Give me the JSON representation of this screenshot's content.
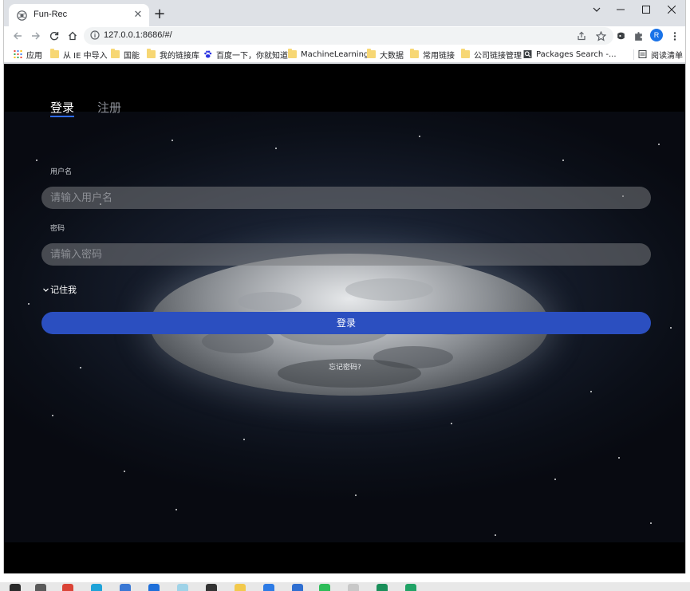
{
  "browser": {
    "tab_title": "Fun-Rec",
    "url": "127.0.0.1:8686/#/",
    "profile_initial": "R"
  },
  "bookmarks": [
    {
      "label": "应用",
      "icon": "apps-grid-icon"
    },
    {
      "label": "从 IE 中导入",
      "icon": "folder-icon"
    },
    {
      "label": "国能",
      "icon": "folder-icon"
    },
    {
      "label": "我的链接库",
      "icon": "folder-icon"
    },
    {
      "label": "百度一下，你就知道",
      "icon": "baidu-paw-icon"
    },
    {
      "label": "MachineLearning",
      "icon": "folder-icon"
    },
    {
      "label": "大数据",
      "icon": "folder-icon"
    },
    {
      "label": "常用链接",
      "icon": "folder-icon"
    },
    {
      "label": "公司链接管理",
      "icon": "folder-icon"
    },
    {
      "label": "Packages Search -...",
      "icon": "search-icon"
    },
    {
      "label": "阅读清单",
      "icon": "reading-list-icon"
    }
  ],
  "login": {
    "tab_login": "登录",
    "tab_register": "注册",
    "username_label": "用户名",
    "username_placeholder": "请输入用户名",
    "password_label": "密码",
    "password_placeholder": "请输入密码",
    "remember_label": "记住我",
    "submit_label": "登录",
    "forgot_label": "忘记密码?"
  },
  "colors": {
    "accent_blue": "#2b4fc0",
    "tab_underline": "#2f6bff",
    "background": "#080a11"
  }
}
